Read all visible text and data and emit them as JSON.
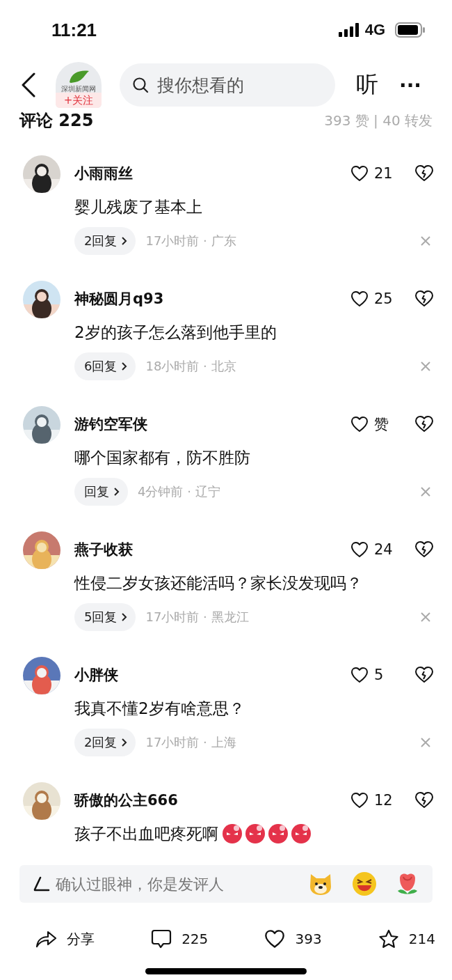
{
  "status_bar": {
    "time": "11:21",
    "network": "4G"
  },
  "header": {
    "account_logo": "深圳新闻网",
    "follow": "+关注",
    "search": {
      "placeholder": "搜你想看的"
    },
    "listen": "听",
    "more": "···"
  },
  "comments_header": {
    "title": "评论 225",
    "stats": "393 赞 | 40 转发"
  },
  "comments": [
    {
      "user": "小雨雨丝",
      "text": "婴儿残废了基本上",
      "likes": "21",
      "replies": "2回复",
      "time": "17小时前 · 广东"
    },
    {
      "user": "神秘圆月q93",
      "text": "2岁的孩子怎么落到他手里的",
      "likes": "25",
      "replies": "6回复",
      "time": "18小时前 · 北京"
    },
    {
      "user": "游钓空军侠",
      "text": "哪个国家都有，防不胜防",
      "likes": "赞",
      "replies": "回复",
      "time": "4分钟前 · 辽宁"
    },
    {
      "user": "燕子收获",
      "text": "性侵二岁女孩还能活吗？家长没发现吗？",
      "likes": "24",
      "replies": "5回复",
      "time": "17小时前 · 黑龙江"
    },
    {
      "user": "小胖侠",
      "text": "我真不懂2岁有啥意思？",
      "likes": "5",
      "replies": "2回复",
      "time": "17小时前 · 上海"
    },
    {
      "user": "骄傲的公主666",
      "text": "孩子不出血吧疼死啊",
      "likes": "12",
      "emojis": [
        {
          "kind": "angry"
        },
        {
          "kind": "angry"
        },
        {
          "kind": "angry"
        },
        {
          "kind": "angry"
        }
      ]
    }
  ],
  "input": {
    "placeholder": "确认过眼神，你是发评人"
  },
  "actions": [
    {
      "kind": "share",
      "label": "分享"
    },
    {
      "kind": "comment",
      "label": "225"
    },
    {
      "kind": "like",
      "label": "393"
    },
    {
      "kind": "favorite",
      "label": "214"
    }
  ]
}
